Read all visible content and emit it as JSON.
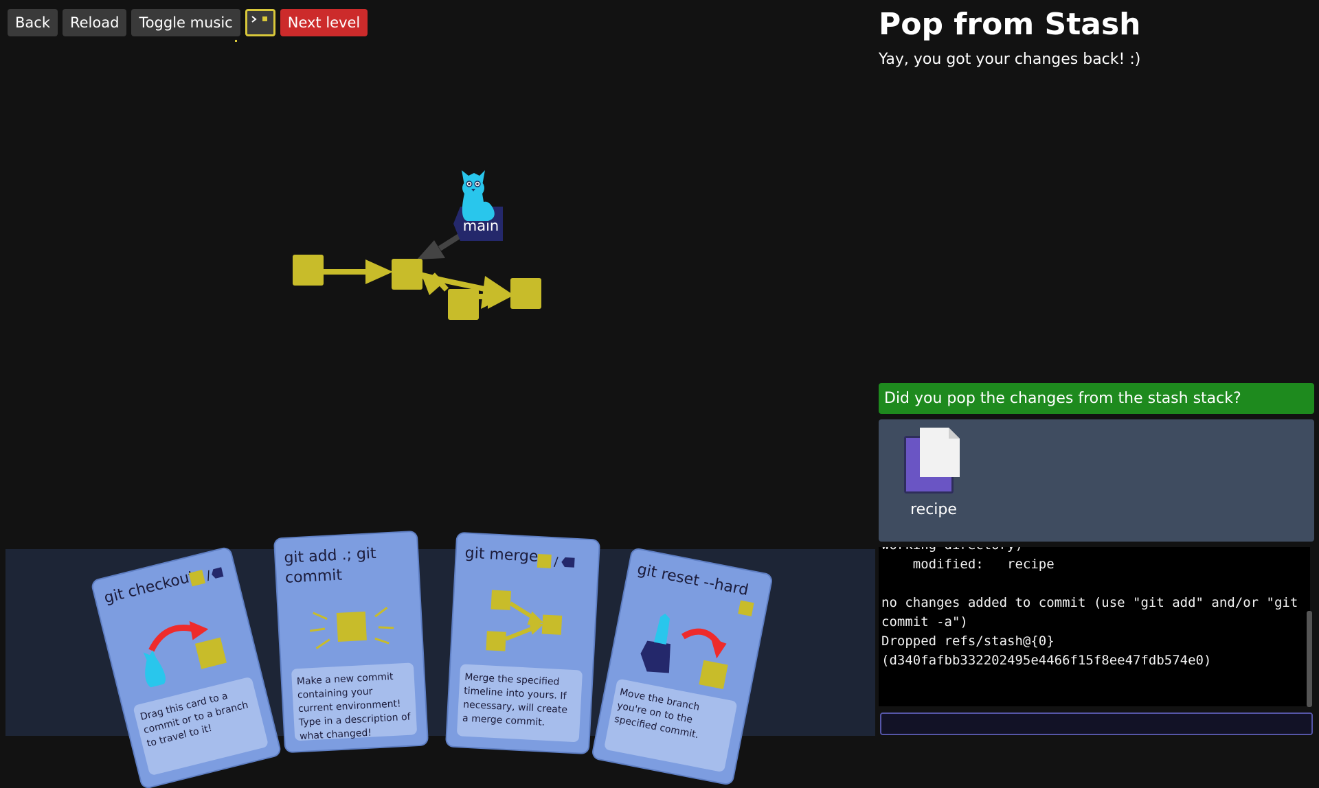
{
  "toolbar": {
    "back_label": "Back",
    "reload_label": "Reload",
    "music_label": "Toggle music",
    "next_label": "Next level"
  },
  "level": {
    "title": "Pop from Stash",
    "description": "Yay, you got your changes back! :)",
    "goal": "Did you pop the changes from the stash stack?"
  },
  "graph": {
    "branch_label": "main",
    "commit_color": "#c8bc2a",
    "branch_color": "#24286b",
    "head_color": "#29c6ec"
  },
  "files": [
    {
      "name": "recipe"
    }
  ],
  "terminal": {
    "output": "working directory)\n    modified:   recipe\n\nno changes added to commit (use \"git add\" and/or \"git commit -a\")\nDropped refs/stash@{0}\n(d340fafbb332202495e4466f15f8ee47fdb574e0)",
    "input_value": ""
  },
  "cards": [
    {
      "title": "git checkout",
      "description": "Drag this card to a commit or to a branch to travel to it!"
    },
    {
      "title": "git add .; git commit",
      "description": "Make a new commit containing your current environment! Type in a description of what changed!"
    },
    {
      "title": "git merge",
      "description": "Merge the specified timeline into yours. If necessary, will create a merge commit."
    },
    {
      "title": "git reset --hard",
      "description": "Move the branch you're on to the specified commit."
    }
  ],
  "colors": {
    "background": "#121212",
    "goal_ok": "#1e8a1e",
    "next_button": "#cc2b2b",
    "card": "#7d9de0"
  }
}
